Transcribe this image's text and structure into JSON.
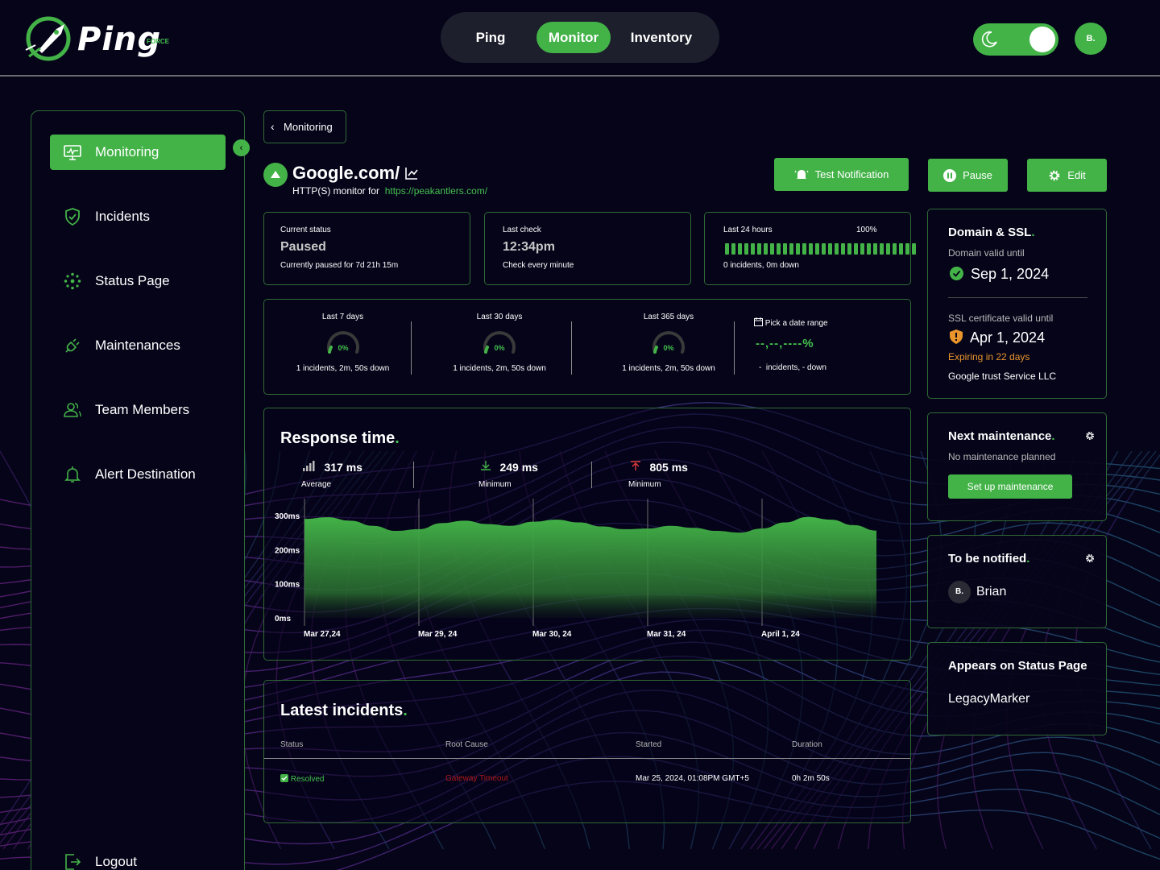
{
  "app": {
    "logo_text": "Ping",
    "logo_sub": "FORCE"
  },
  "nav": {
    "items": [
      "Ping",
      "Monitor",
      "Inventory"
    ],
    "active": "Monitor"
  },
  "user": {
    "avatar_initial": "B."
  },
  "sidebar": {
    "items": [
      {
        "label": "Monitoring",
        "icon": "monitor-icon",
        "active": true
      },
      {
        "label": "Incidents",
        "icon": "shield-check-icon"
      },
      {
        "label": "Status Page",
        "icon": "status-icon"
      },
      {
        "label": "Maintenances",
        "icon": "plug-icon"
      },
      {
        "label": "Team Members",
        "icon": "users-icon"
      },
      {
        "label": "Alert Destination",
        "icon": "bell-icon"
      }
    ],
    "logout": "Logout"
  },
  "breadcrumb": {
    "back_label": "Monitoring"
  },
  "monitor": {
    "name": "Google.com/",
    "subtitle": "HTTP(S) monitor for",
    "url": "https://peakantlers.com/"
  },
  "actions": {
    "test_notification": "Test Notification",
    "pause": "Pause",
    "edit": "Edit"
  },
  "stats": {
    "current": {
      "label": "Current status",
      "value": "Paused",
      "foot": "Currently paused for 7d 21h 15m"
    },
    "last_check": {
      "label": "Last check",
      "value": "12:34pm",
      "foot": "Check every minute"
    },
    "last24": {
      "label": "Last 24 hours",
      "percent": "100%",
      "foot": "0 incidents, 0m down",
      "bar_count": 30
    }
  },
  "uptime": {
    "periods": [
      {
        "title": "Last 7 days",
        "value": "0%",
        "foot": "1 incidents, 2m, 50s down"
      },
      {
        "title": "Last 30 days",
        "value": "0%",
        "foot": "1 incidents, 2m, 50s down"
      },
      {
        "title": "Last 365 days",
        "value": "0%",
        "foot": "1 incidents, 2m, 50s down"
      }
    ],
    "range": {
      "title": "Pick a date range",
      "value": "--,--,----%",
      "foot": "-  incidents, - down"
    }
  },
  "response": {
    "title": "Response time",
    "metrics": [
      {
        "value": "317 ms",
        "label": "Average",
        "icon": "signal-icon"
      },
      {
        "value": "249 ms",
        "label": "Minimum",
        "icon": "download-icon"
      },
      {
        "value": "805 ms",
        "label": "Minimum",
        "icon": "upload-icon"
      }
    ]
  },
  "chart_data": {
    "type": "area",
    "title": "Response time",
    "yticks": [
      "300ms",
      "200ms",
      "100ms",
      "0ms"
    ],
    "ylim": [
      0,
      300
    ],
    "xticks": [
      "Mar 27,24",
      "Mar 29, 24",
      "Mar 30, 24",
      "Mar 31, 24",
      "April 1, 24"
    ],
    "grid": "vertical",
    "series": [
      {
        "values": [
          290,
          295,
          285,
          270,
          255,
          260,
          278,
          285,
          275,
          270,
          282,
          288,
          280,
          268,
          260,
          262,
          270,
          264,
          255,
          250,
          262,
          280,
          296,
          288,
          272,
          256
        ]
      }
    ],
    "color": "#43b348"
  },
  "incidents": {
    "title": "Latest incidents",
    "columns": [
      "Status",
      "Root Cause",
      "Started",
      "Duration"
    ],
    "rows": [
      {
        "status": "Resolved",
        "cause": "Gateway Timeout",
        "started": "Mar 25, 2024, 01:08PM GMT+5",
        "duration": "0h 2m 50s"
      }
    ]
  },
  "domain_ssl": {
    "title": "Domain & SSL",
    "domain_label": "Domain valid until",
    "domain_date": "Sep 1, 2024",
    "ssl_label": "SSL certificate valid until",
    "ssl_date": "Apr 1, 2024",
    "ssl_warning": "Expiring in 22 days",
    "issuer": "Google trust Service LLC"
  },
  "maintenance": {
    "title": "Next maintenance",
    "sub": "No maintenance planned",
    "button": "Set up maintenance"
  },
  "notified": {
    "title": "To be notified",
    "initial": "B.",
    "name": "Brian"
  },
  "status_page": {
    "title": "Appears on Status Page",
    "value": "LegacyMarker"
  }
}
